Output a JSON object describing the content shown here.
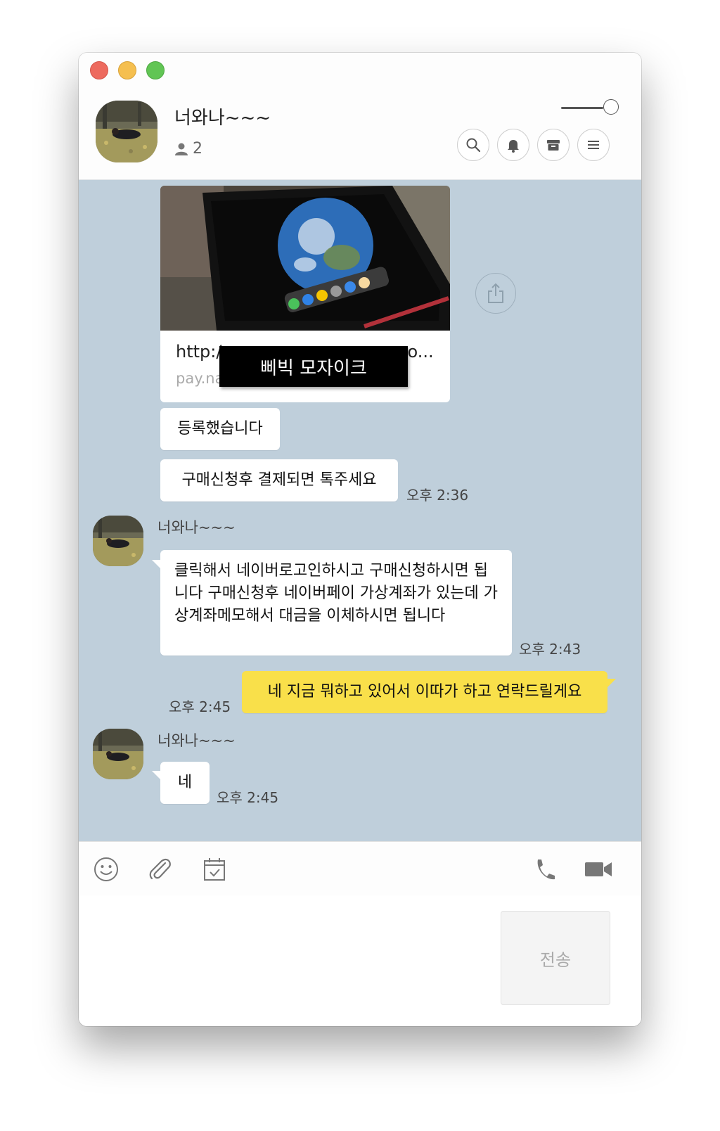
{
  "window": {
    "room_title": "너와나~~~",
    "member_count": "2"
  },
  "messages": {
    "link": {
      "url_text": "http:/",
      "url_trail": "o...",
      "domain": "pay.na",
      "mosaic_label": "삐빅 모자이크"
    },
    "m1": {
      "text": "등록했습니다"
    },
    "m2": {
      "text": "구매신청후 결제되면 톡주세요",
      "time": "오후 2:36"
    },
    "m3": {
      "sender": "너와나~~~",
      "text": "클릭해서 네이버로고인하시고 구매신청하시면 됩니다 구매신청후 네이버페이 가상계좌가 있는데 가상계좌메모해서 대금을 이체하시면 됩니다",
      "time": "오후 2:43"
    },
    "m4": {
      "text": "네 지금 뭐하고 있어서 이따가 하고 연락드릴게요",
      "time": "오후 2:45"
    },
    "m5": {
      "sender": "너와나~~~",
      "text": "네",
      "time": "오후 2:45"
    }
  },
  "input": {
    "send_label": "전송"
  },
  "icons": {
    "header": [
      "search-icon",
      "bell-icon",
      "archive-icon",
      "menu-icon"
    ],
    "toolbar": [
      "emoji-icon",
      "attach-icon",
      "calendar-icon",
      "phone-icon",
      "video-icon"
    ]
  },
  "colors": {
    "chat_background": "#bfcfdb",
    "my_bubble": "#f9e04a",
    "their_bubble": "#ffffff"
  }
}
